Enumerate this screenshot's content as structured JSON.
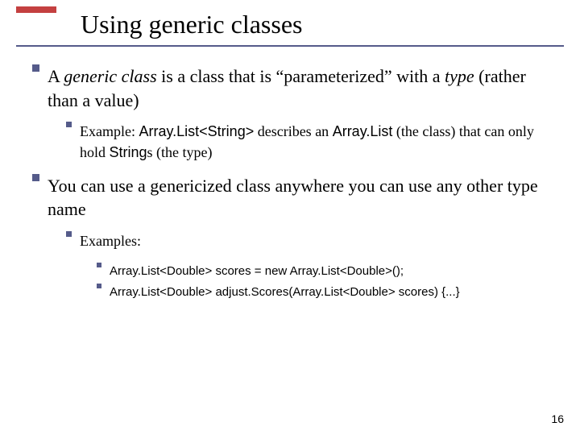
{
  "slide": {
    "title": "Using generic classes",
    "pageNumber": "16"
  },
  "points": {
    "p1": {
      "pre": "A ",
      "i1": "generic class",
      "mid": " is a class that is “parameterized” with a ",
      "i2": "type",
      "post": " (rather than a value)"
    },
    "p1a": {
      "pre": "Example: ",
      "c1": "Array.List<String>",
      "mid1": " describes an ",
      "c2": "Array.List",
      "mid2": " (the class) that can only hold ",
      "c3": "String",
      "post": "s (the type)"
    },
    "p2": "You can use a genericized class anywhere you can use any other type name",
    "p2a": "Examples:",
    "ex1": "Array.List<Double> scores = new Array.List<Double>();",
    "ex2": "Array.List<Double> adjust.Scores(Array.List<Double> scores) {...}"
  }
}
